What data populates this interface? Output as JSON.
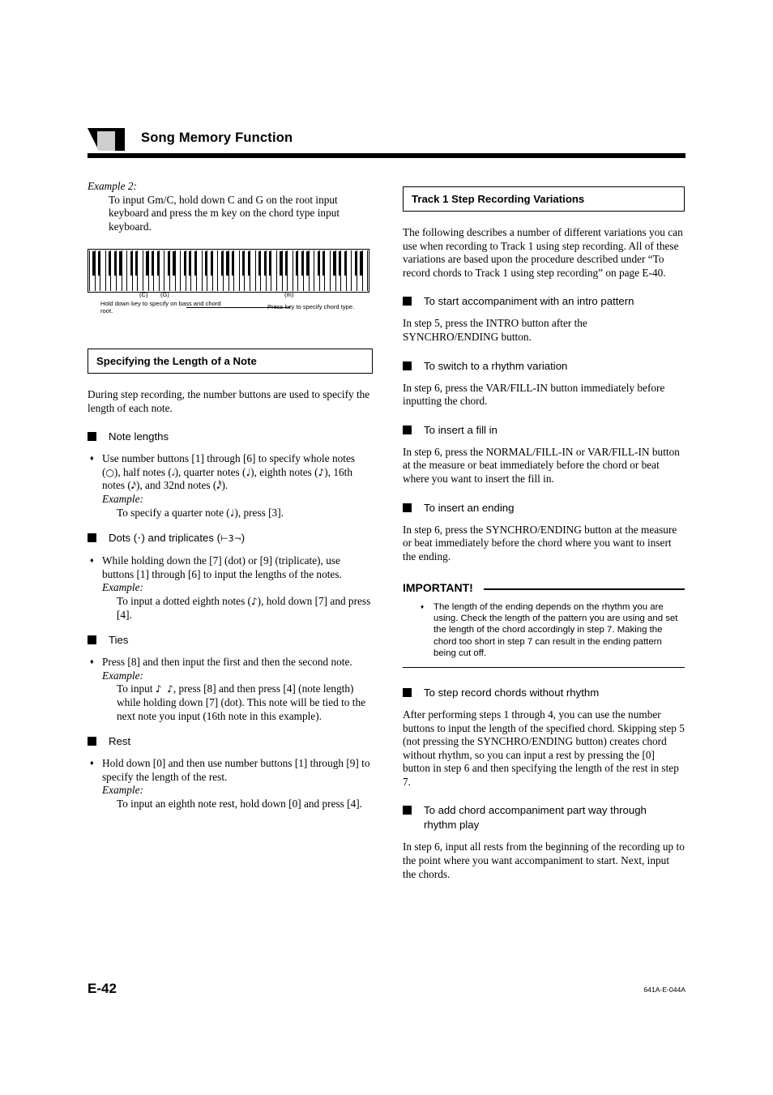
{
  "header": {
    "title": "Song Memory Function"
  },
  "left": {
    "example2_label": "Example 2:",
    "example2_body": "To input Gm/C, hold down C and G on the root input keyboard and press the m key on the chord type input keyboard.",
    "figure": {
      "label_c": "(C)",
      "label_g": "(G)",
      "label_m": "(m)",
      "caption_left": "Hold down key to specify on bass and chord root.",
      "caption_right": "Press key to specify chord type."
    },
    "section_title": "Specifying the Length of a Note",
    "intro": "During step recording, the number buttons are used to specify the length of each note.",
    "h_note_lengths": "Note lengths",
    "note_lengths_item": "Use number buttons [1] through [6] to specify whole notes ( ), half notes ( ), quarter notes ( ), eighth notes ( ), 16th notes ( ), and 32nd notes ( ).",
    "note_lengths_example_label": "Example:",
    "note_lengths_example": "To specify a quarter note ( ), press [3].",
    "h_dots": "Dots (  ) and triplicates (      )",
    "dots_item": "While holding down the [7] (dot) or [9] (triplicate), use buttons [1] through [6] to input the lengths of the notes.",
    "dots_example_label": "Example:",
    "dots_example": "To input a dotted eighth notes ( ), hold down [7] and press [4].",
    "h_ties": "Ties",
    "ties_item": "Press [8] and then input the first and then the second note.",
    "ties_example_label": "Example:",
    "ties_example": "To input    , press [8] and then press [4] (note length) while holding down [7] (dot). This note will be tied to the next note you input (16th note in this example).",
    "h_rest": "Rest",
    "rest_item": "Hold down [0] and then use number buttons [1] through [9] to specify the length of the rest.",
    "rest_example_label": "Example:",
    "rest_example": "To input an eighth note rest, hold down [0] and press [4]."
  },
  "right": {
    "section_title": "Track 1 Step Recording Variations",
    "intro": "The following describes a number of different variations you can use when recording to Track 1 using step recording. All of these variations are based upon the procedure described under “To record chords to Track 1 using step recording” on page E-40.",
    "h_intro_pattern": "To start accompaniment with an intro pattern",
    "p_intro_pattern": "In step 5, press the INTRO button after the SYNCHRO/ENDING button.",
    "h_rhythm_variation": "To switch to a rhythm variation",
    "p_rhythm_variation": "In step 6, press the VAR/FILL-IN button immediately before inputting the chord.",
    "h_fill_in": "To insert a fill in",
    "p_fill_in": "In step 6, press the NORMAL/FILL-IN or VAR/FILL-IN button at the measure or beat immediately before the chord or beat where you want to insert the fill in.",
    "h_ending": "To insert an ending",
    "p_ending": "In step 6, press the SYNCHRO/ENDING button at the measure or beat immediately before the chord where you want to insert the ending.",
    "important_title": "IMPORTANT!",
    "important_item": "The length of the ending depends on the rhythm you are using. Check the length of the pattern you are using and set the length of the chord accordingly in step 7. Making the chord too short in step 7 can result in the ending pattern being cut off.",
    "h_without_rhythm": "To step record chords without rhythm",
    "p_without_rhythm": "After performing steps 1 through 4, you can use the number buttons to input the length of the specified chord. Skipping step 5 (not pressing the SYNCHRO/ENDING button) creates chord without rhythm, so you can input a rest by pressing the [0] button in step 6 and then specifying the length of the rest in step 7.",
    "h_part_way": "To add chord accompaniment part way through rhythm play",
    "p_part_way": "In step 6, input all rests from the beginning of the recording up to the point where you want accompaniment to start. Next, input the chords."
  },
  "footer": {
    "page_number": "E-42",
    "doc_code": "641A-E-044A"
  }
}
